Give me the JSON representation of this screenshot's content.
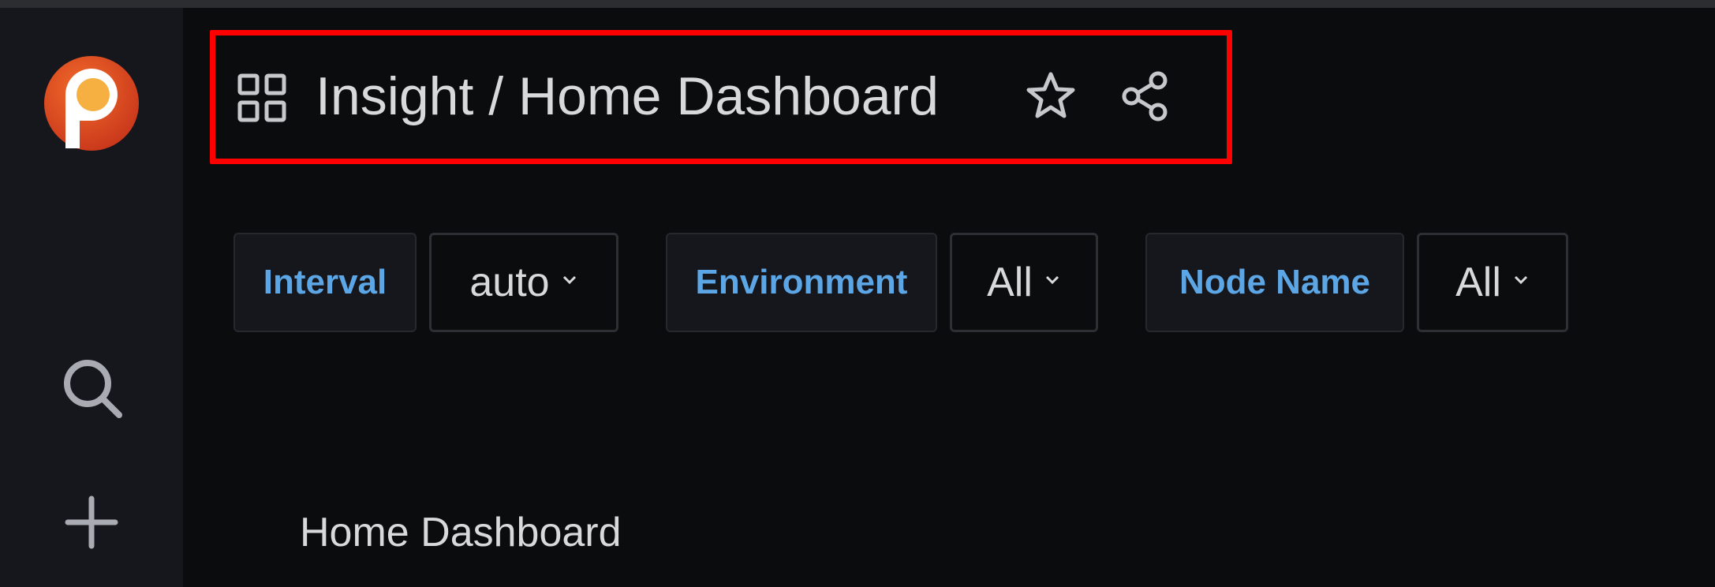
{
  "app": {
    "logo_icon": "percona-logo-icon",
    "accent_color": "#5ca6e6",
    "highlight_color": "#ff0000"
  },
  "sidebar": {
    "items": [
      {
        "icon": "search-icon"
      },
      {
        "icon": "plus-icon"
      }
    ]
  },
  "header": {
    "folder": "Insight",
    "separator": " / ",
    "dashboard": "Home Dashboard",
    "icons": [
      "dashboard-grid-icon",
      "star-icon",
      "share-icon"
    ]
  },
  "variables": [
    {
      "label": "Interval",
      "value": "auto"
    },
    {
      "label": "Environment",
      "value": "All"
    },
    {
      "label": "Node Name",
      "value": "All"
    }
  ],
  "panel": {
    "title": "Home Dashboard"
  }
}
